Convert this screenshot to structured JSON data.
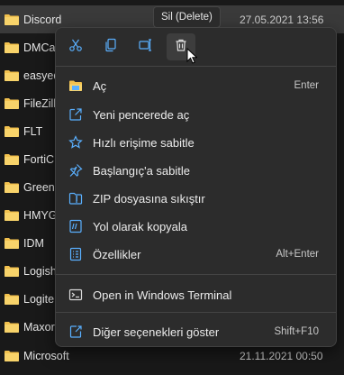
{
  "files": [
    {
      "name": "Discord",
      "date": "27.05.2021 13:56",
      "selected": true
    },
    {
      "name": "DMCa",
      "date": ""
    },
    {
      "name": "easyed",
      "date": ""
    },
    {
      "name": "FileZill",
      "date": ""
    },
    {
      "name": "FLT",
      "date": ""
    },
    {
      "name": "FortiC",
      "date": ""
    },
    {
      "name": "Greens",
      "date": ""
    },
    {
      "name": "HMYG",
      "date": ""
    },
    {
      "name": "IDM",
      "date": ""
    },
    {
      "name": "Logish",
      "date": ""
    },
    {
      "name": "Logite",
      "date": ""
    },
    {
      "name": "Maxor",
      "date": ""
    },
    {
      "name": "Microsoft",
      "date": "21.11.2021 00:50"
    }
  ],
  "tooltip": "Sil (Delete)",
  "command_bar": {
    "cut_icon": "scissors-icon",
    "copy_icon": "copy-icon",
    "rename_icon": "rename-icon",
    "delete_icon": "trash-icon"
  },
  "menu": {
    "open": {
      "label": "Aç",
      "shortcut": "Enter"
    },
    "open_new_window": {
      "label": "Yeni pencerede aç"
    },
    "pin_quick_access": {
      "label": "Hızlı erişime sabitle"
    },
    "pin_start": {
      "label": "Başlangıç'a sabitle"
    },
    "compress_zip": {
      "label": "ZIP dosyasına sıkıştır"
    },
    "copy_path": {
      "label": "Yol olarak kopyala"
    },
    "properties": {
      "label": "Özellikler",
      "shortcut": "Alt+Enter"
    },
    "open_terminal": {
      "label": "Open in Windows Terminal"
    },
    "more_options": {
      "label": "Diğer seçenekleri göster",
      "shortcut": "Shift+F10"
    }
  },
  "colors": {
    "accent": "#5ab0ff",
    "folder": "#f2c14e",
    "menu_bg": "#2c2c2c",
    "background": "#191919"
  }
}
